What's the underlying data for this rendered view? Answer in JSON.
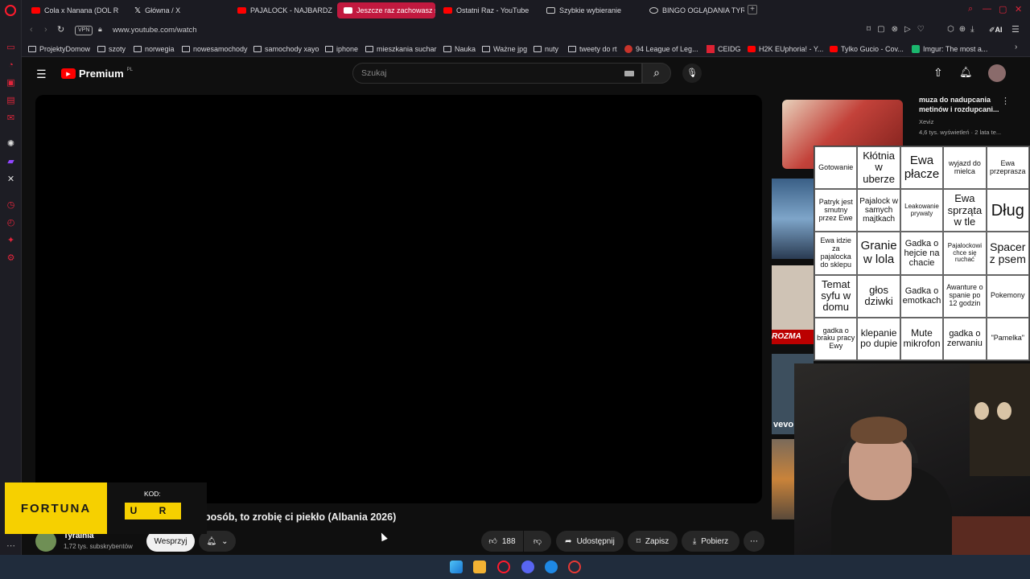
{
  "tabs": [
    {
      "label": "Cola x Nanana (DOL R",
      "icon": "youtube-icon"
    },
    {
      "label": "Główna / X",
      "icon": "x-icon"
    },
    {
      "label": "PAJALOCK - NAJBARDZI",
      "icon": "youtube-icon"
    },
    {
      "label": "Jeszcze raz zachowasz s",
      "icon": "youtube-icon",
      "active": true
    },
    {
      "label": "Ostatni Raz - YouTube",
      "icon": "youtube-icon"
    },
    {
      "label": "Szybkie wybieranie",
      "icon": "grid-icon"
    },
    {
      "label": "BINGO OGLĄDANIA TYRA",
      "icon": "cloud-icon"
    }
  ],
  "address": {
    "url": "www.youtube.com/watch",
    "vpn": "VPN"
  },
  "bookmarks": [
    "ProjektyDomow",
    "szoty",
    "norwegia",
    "nowesamochody",
    "samochody xayo",
    "iphone",
    "mieszkania suchar",
    "Nauka",
    "Ważne jpg",
    "nuty",
    "tweety do rt",
    "94 League of Leg...",
    "CEIDG",
    "H2K EUphoria! - Y...",
    "Tylko Gucio - Cov...",
    "Imgur: The most a..."
  ],
  "youtube": {
    "logo": "Premium",
    "logo_region": "PL",
    "search_placeholder": "Szukaj",
    "video_title": "posób, to zrobię ci piekło (Albania 2026)",
    "channel_name": "Tyralnia",
    "subscribers": "1,72 tys. subskrybentów",
    "join_label": "Wesprzyj",
    "likes": "188",
    "share_label": "Udostępnij",
    "save_label": "Zapisz",
    "download_label": "Pobierz",
    "rec_title": "muza do nadupcania metinów i rozdupcani...",
    "rec_channel": "Xeviz",
    "rec_meta": "4,6 tys. wyświetleń · 2 lata te...",
    "side_label_1": "ROZMA",
    "side_label_2": "vevo"
  },
  "fortuna": {
    "brand": "FORTUNA",
    "code_label": "KOD:",
    "code": "U R"
  },
  "bingo": [
    {
      "text": "Gotowanie",
      "size": 9
    },
    {
      "text": "Kłótnia w uberze",
      "size": 13
    },
    {
      "text": "Ewa płacze",
      "size": 15
    },
    {
      "text": "wyjazd do mielca",
      "size": 9
    },
    {
      "text": "Ewa przeprasza",
      "size": 9
    },
    {
      "text": "Patryk jest smutny przez Ewe",
      "size": 9
    },
    {
      "text": "Pajalock w samych majtkach",
      "size": 10
    },
    {
      "text": "Leakowanie prywaty",
      "size": 8
    },
    {
      "text": "Ewa sprząta w tle",
      "size": 13
    },
    {
      "text": "Dług",
      "size": 20
    },
    {
      "text": "Ewa idzie za pajalocka do sklepu",
      "size": 9
    },
    {
      "text": "Granie w lola",
      "size": 15
    },
    {
      "text": "Gadka o hejcie na chacie",
      "size": 11
    },
    {
      "text": "Pajalockowi chce się ruchać",
      "size": 8
    },
    {
      "text": "Spacer z psem",
      "size": 14
    },
    {
      "text": "Temat syfu w domu",
      "size": 13
    },
    {
      "text": "głos dziwki",
      "size": 13
    },
    {
      "text": "Gadka o emotkach",
      "size": 11
    },
    {
      "text": "Awanture o spanie po 12 godzin",
      "size": 9
    },
    {
      "text": "Pokemony",
      "size": 9
    },
    {
      "text": "gadka o braku pracy Ewy",
      "size": 9
    },
    {
      "text": "klepanie po dupie",
      "size": 12
    },
    {
      "text": "Mute mikrofon",
      "size": 12
    },
    {
      "text": "gadka o zerwaniu",
      "size": 11
    },
    {
      "text": "\"Pamelka\"",
      "size": 9
    }
  ],
  "colors": {
    "yt_red": "#ff0000",
    "opera_red": "#c1193f",
    "fortuna_yellow": "#f6d000"
  }
}
